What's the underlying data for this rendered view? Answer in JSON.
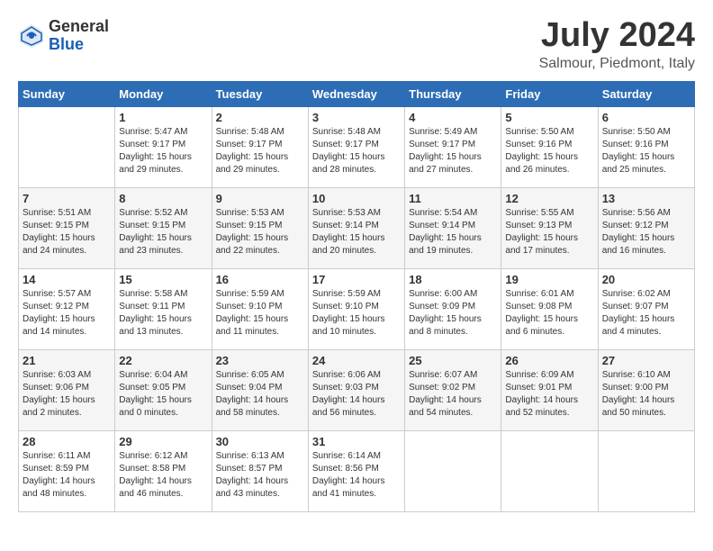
{
  "header": {
    "logo_general": "General",
    "logo_blue": "Blue",
    "month_year": "July 2024",
    "location": "Salmour, Piedmont, Italy"
  },
  "calendar": {
    "weekdays": [
      "Sunday",
      "Monday",
      "Tuesday",
      "Wednesday",
      "Thursday",
      "Friday",
      "Saturday"
    ],
    "weeks": [
      [
        {
          "day": "",
          "info": ""
        },
        {
          "day": "1",
          "info": "Sunrise: 5:47 AM\nSunset: 9:17 PM\nDaylight: 15 hours\nand 29 minutes."
        },
        {
          "day": "2",
          "info": "Sunrise: 5:48 AM\nSunset: 9:17 PM\nDaylight: 15 hours\nand 29 minutes."
        },
        {
          "day": "3",
          "info": "Sunrise: 5:48 AM\nSunset: 9:17 PM\nDaylight: 15 hours\nand 28 minutes."
        },
        {
          "day": "4",
          "info": "Sunrise: 5:49 AM\nSunset: 9:17 PM\nDaylight: 15 hours\nand 27 minutes."
        },
        {
          "day": "5",
          "info": "Sunrise: 5:50 AM\nSunset: 9:16 PM\nDaylight: 15 hours\nand 26 minutes."
        },
        {
          "day": "6",
          "info": "Sunrise: 5:50 AM\nSunset: 9:16 PM\nDaylight: 15 hours\nand 25 minutes."
        }
      ],
      [
        {
          "day": "7",
          "info": "Sunrise: 5:51 AM\nSunset: 9:15 PM\nDaylight: 15 hours\nand 24 minutes."
        },
        {
          "day": "8",
          "info": "Sunrise: 5:52 AM\nSunset: 9:15 PM\nDaylight: 15 hours\nand 23 minutes."
        },
        {
          "day": "9",
          "info": "Sunrise: 5:53 AM\nSunset: 9:15 PM\nDaylight: 15 hours\nand 22 minutes."
        },
        {
          "day": "10",
          "info": "Sunrise: 5:53 AM\nSunset: 9:14 PM\nDaylight: 15 hours\nand 20 minutes."
        },
        {
          "day": "11",
          "info": "Sunrise: 5:54 AM\nSunset: 9:14 PM\nDaylight: 15 hours\nand 19 minutes."
        },
        {
          "day": "12",
          "info": "Sunrise: 5:55 AM\nSunset: 9:13 PM\nDaylight: 15 hours\nand 17 minutes."
        },
        {
          "day": "13",
          "info": "Sunrise: 5:56 AM\nSunset: 9:12 PM\nDaylight: 15 hours\nand 16 minutes."
        }
      ],
      [
        {
          "day": "14",
          "info": "Sunrise: 5:57 AM\nSunset: 9:12 PM\nDaylight: 15 hours\nand 14 minutes."
        },
        {
          "day": "15",
          "info": "Sunrise: 5:58 AM\nSunset: 9:11 PM\nDaylight: 15 hours\nand 13 minutes."
        },
        {
          "day": "16",
          "info": "Sunrise: 5:59 AM\nSunset: 9:10 PM\nDaylight: 15 hours\nand 11 minutes."
        },
        {
          "day": "17",
          "info": "Sunrise: 5:59 AM\nSunset: 9:10 PM\nDaylight: 15 hours\nand 10 minutes."
        },
        {
          "day": "18",
          "info": "Sunrise: 6:00 AM\nSunset: 9:09 PM\nDaylight: 15 hours\nand 8 minutes."
        },
        {
          "day": "19",
          "info": "Sunrise: 6:01 AM\nSunset: 9:08 PM\nDaylight: 15 hours\nand 6 minutes."
        },
        {
          "day": "20",
          "info": "Sunrise: 6:02 AM\nSunset: 9:07 PM\nDaylight: 15 hours\nand 4 minutes."
        }
      ],
      [
        {
          "day": "21",
          "info": "Sunrise: 6:03 AM\nSunset: 9:06 PM\nDaylight: 15 hours\nand 2 minutes."
        },
        {
          "day": "22",
          "info": "Sunrise: 6:04 AM\nSunset: 9:05 PM\nDaylight: 15 hours\nand 0 minutes."
        },
        {
          "day": "23",
          "info": "Sunrise: 6:05 AM\nSunset: 9:04 PM\nDaylight: 14 hours\nand 58 minutes."
        },
        {
          "day": "24",
          "info": "Sunrise: 6:06 AM\nSunset: 9:03 PM\nDaylight: 14 hours\nand 56 minutes."
        },
        {
          "day": "25",
          "info": "Sunrise: 6:07 AM\nSunset: 9:02 PM\nDaylight: 14 hours\nand 54 minutes."
        },
        {
          "day": "26",
          "info": "Sunrise: 6:09 AM\nSunset: 9:01 PM\nDaylight: 14 hours\nand 52 minutes."
        },
        {
          "day": "27",
          "info": "Sunrise: 6:10 AM\nSunset: 9:00 PM\nDaylight: 14 hours\nand 50 minutes."
        }
      ],
      [
        {
          "day": "28",
          "info": "Sunrise: 6:11 AM\nSunset: 8:59 PM\nDaylight: 14 hours\nand 48 minutes."
        },
        {
          "day": "29",
          "info": "Sunrise: 6:12 AM\nSunset: 8:58 PM\nDaylight: 14 hours\nand 46 minutes."
        },
        {
          "day": "30",
          "info": "Sunrise: 6:13 AM\nSunset: 8:57 PM\nDaylight: 14 hours\nand 43 minutes."
        },
        {
          "day": "31",
          "info": "Sunrise: 6:14 AM\nSunset: 8:56 PM\nDaylight: 14 hours\nand 41 minutes."
        },
        {
          "day": "",
          "info": ""
        },
        {
          "day": "",
          "info": ""
        },
        {
          "day": "",
          "info": ""
        }
      ]
    ]
  }
}
